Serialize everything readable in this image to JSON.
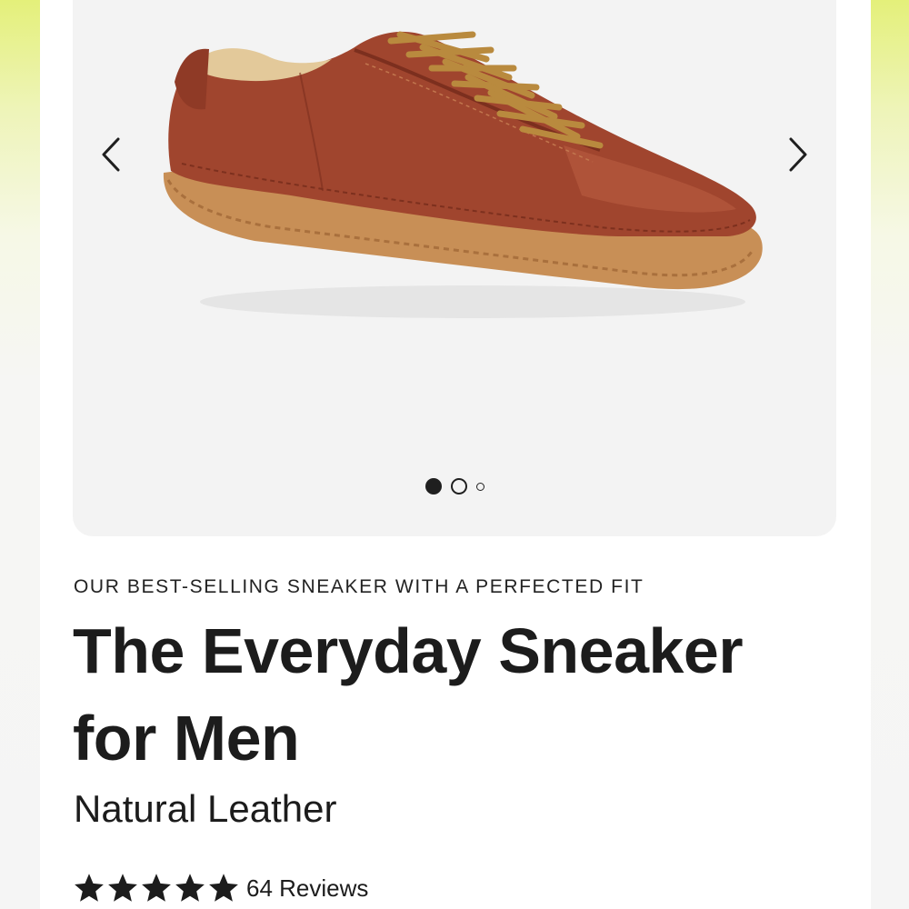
{
  "gallery": {
    "image_subject": "brown leather sneaker with tan laces and gum sole",
    "prev_icon": "chevron-left-icon",
    "next_icon": "chevron-right-icon",
    "dots": [
      {
        "state": "active"
      },
      {
        "state": "inactive"
      },
      {
        "state": "inactive-small"
      }
    ]
  },
  "product": {
    "eyebrow": "OUR BEST-SELLING SNEAKER WITH A PERFECTED FIT",
    "title_line1": "The Everyday Sneaker",
    "title_line2": "for Men",
    "material": "Natural Leather",
    "rating": {
      "stars": 5,
      "star_icon": "star-icon",
      "reviews_label": "64 Reviews"
    }
  },
  "colors": {
    "background_accent": "#e4f07a",
    "leather": "#a0452e",
    "sole": "#c88f56",
    "laces": "#b98a3e",
    "text": "#1c1c1c"
  }
}
